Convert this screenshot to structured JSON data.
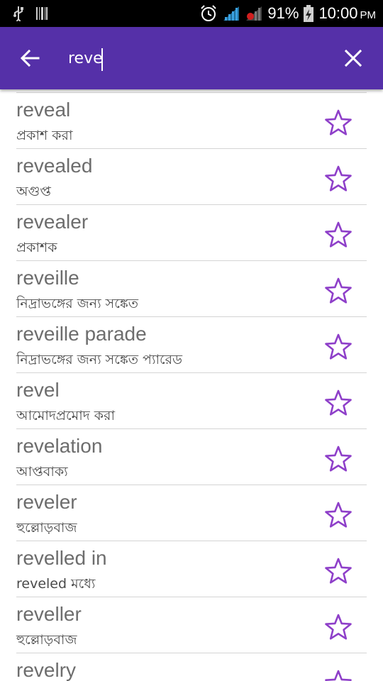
{
  "status_bar": {
    "battery_percent": "91%",
    "time": "10:00",
    "ampm": "PM",
    "icons": [
      "usb-icon",
      "barcode-icon",
      "alarm-icon",
      "signal-icon",
      "signal-roaming-icon",
      "battery-charging-icon"
    ]
  },
  "app_bar": {
    "background": "#5530a8",
    "search_value": "reve",
    "back_icon": "arrow-back-icon",
    "close_icon": "close-icon"
  },
  "accent": "#8e3fc9",
  "results": [
    {
      "word": "reveal",
      "meaning": "প্রকাশ করা"
    },
    {
      "word": "revealed",
      "meaning": "অগুপ্ত"
    },
    {
      "word": "revealer",
      "meaning": "প্রকাশক"
    },
    {
      "word": "reveille",
      "meaning": "নিদ্রাভঙ্গের জন্য সঙ্কেত"
    },
    {
      "word": "reveille parade",
      "meaning": "নিদ্রাভঙ্গের জন্য সঙ্কেত প্যারেড"
    },
    {
      "word": "revel",
      "meaning": "আমোদপ্রমোদ করা"
    },
    {
      "word": "revelation",
      "meaning": "আপ্তবাক্য"
    },
    {
      "word": "reveler",
      "meaning": "হুল্লোড়বাজ"
    },
    {
      "word": "revelled in",
      "meaning": "reveled মধ্যে"
    },
    {
      "word": "reveller",
      "meaning": "হুল্লোড়বাজ"
    },
    {
      "word": "revelry",
      "meaning": ""
    }
  ]
}
